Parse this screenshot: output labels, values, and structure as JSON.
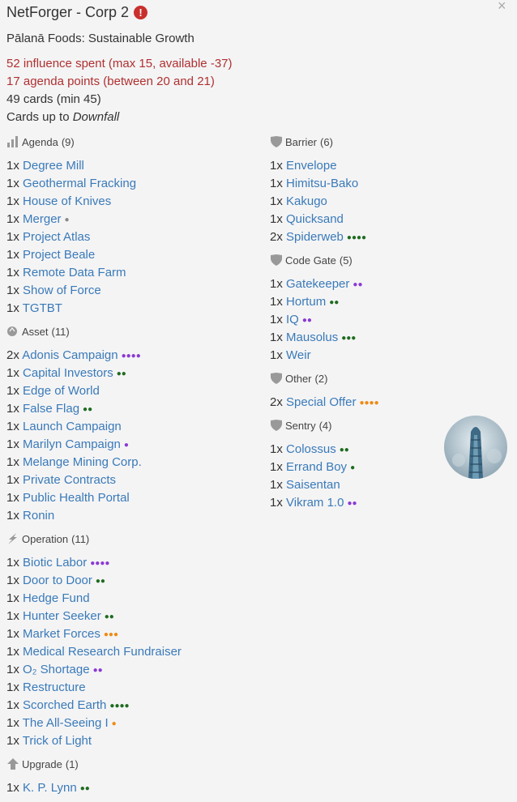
{
  "header": {
    "title": "NetForger - Corp 2",
    "warning_icon": "!",
    "identity": "Pālanā Foods: Sustainable Growth",
    "influence": "52 influence spent (max 15, available -37)",
    "agenda_points": "17 agenda points (between 20 and 21)",
    "cards": "49 cards (min 45)",
    "cards_up_to_prefix": "Cards up to ",
    "cards_up_to_set": "Downfall",
    "close": "×"
  },
  "colors": {
    "link": "#3a7ab8",
    "error": "#b03030",
    "green": "#1e6b1e",
    "purple": "#8a3ad4",
    "orange": "#ef8a12",
    "gray": "#888888"
  },
  "left_column": [
    {
      "type": "Agenda",
      "count": "(9)",
      "icon": "bar-chart-icon",
      "cards": [
        {
          "qty": "1x",
          "name": "Degree Mill",
          "pips": ""
        },
        {
          "qty": "1x",
          "name": "Geothermal Fracking",
          "pips": ""
        },
        {
          "qty": "1x",
          "name": "House of Knives",
          "pips": ""
        },
        {
          "qty": "1x",
          "name": "Merger",
          "pips": "●",
          "color": "gr"
        },
        {
          "qty": "1x",
          "name": "Project Atlas",
          "pips": ""
        },
        {
          "qty": "1x",
          "name": "Project Beale",
          "pips": ""
        },
        {
          "qty": "1x",
          "name": "Remote Data Farm",
          "pips": ""
        },
        {
          "qty": "1x",
          "name": "Show of Force",
          "pips": ""
        },
        {
          "qty": "1x",
          "name": "TGTBT",
          "pips": ""
        }
      ]
    },
    {
      "type": "Asset",
      "count": "(11)",
      "icon": "asset-icon",
      "cards": [
        {
          "qty": "2x",
          "name": "Adonis Campaign",
          "pips": "●●●●",
          "color": "p"
        },
        {
          "qty": "1x",
          "name": "Capital Investors",
          "pips": "●●",
          "color": "g"
        },
        {
          "qty": "1x",
          "name": "Edge of World",
          "pips": ""
        },
        {
          "qty": "1x",
          "name": "False Flag",
          "pips": "●●",
          "color": "g"
        },
        {
          "qty": "1x",
          "name": "Launch Campaign",
          "pips": ""
        },
        {
          "qty": "1x",
          "name": "Marilyn Campaign",
          "pips": "●",
          "color": "p"
        },
        {
          "qty": "1x",
          "name": "Melange Mining Corp.",
          "pips": ""
        },
        {
          "qty": "1x",
          "name": "Private Contracts",
          "pips": ""
        },
        {
          "qty": "1x",
          "name": "Public Health Portal",
          "pips": ""
        },
        {
          "qty": "1x",
          "name": "Ronin",
          "pips": ""
        }
      ]
    },
    {
      "type": "Operation",
      "count": "(11)",
      "icon": "lightning-icon",
      "cards": [
        {
          "qty": "1x",
          "name": "Biotic Labor",
          "pips": "●●●●",
          "color": "p"
        },
        {
          "qty": "1x",
          "name": "Door to Door",
          "pips": "●●",
          "color": "g"
        },
        {
          "qty": "1x",
          "name": "Hedge Fund",
          "pips": ""
        },
        {
          "qty": "1x",
          "name": "Hunter Seeker",
          "pips": "●●",
          "color": "g"
        },
        {
          "qty": "1x",
          "name": "Market Forces",
          "pips": "●●●",
          "color": "o"
        },
        {
          "qty": "1x",
          "name": "Medical Research Fundraiser",
          "pips": ""
        },
        {
          "qty": "1x",
          "name": "O₂ Shortage",
          "pips": "●●",
          "color": "p"
        },
        {
          "qty": "1x",
          "name": "Restructure",
          "pips": ""
        },
        {
          "qty": "1x",
          "name": "Scorched Earth",
          "pips": "●●●●",
          "color": "g"
        },
        {
          "qty": "1x",
          "name": "The All-Seeing I",
          "pips": "●",
          "color": "o"
        },
        {
          "qty": "1x",
          "name": "Trick of Light",
          "pips": ""
        }
      ]
    },
    {
      "type": "Upgrade",
      "count": "(1)",
      "icon": "upgrade-arrow-icon",
      "cards": [
        {
          "qty": "1x",
          "name": "K. P. Lynn",
          "pips": "●●",
          "color": "g"
        }
      ]
    }
  ],
  "right_column": [
    {
      "type": "Barrier",
      "count": "(6)",
      "icon": "shield-icon",
      "cards": [
        {
          "qty": "1x",
          "name": "Envelope",
          "pips": ""
        },
        {
          "qty": "1x",
          "name": "Himitsu-Bako",
          "pips": ""
        },
        {
          "qty": "1x",
          "name": "Kakugo",
          "pips": ""
        },
        {
          "qty": "1x",
          "name": "Quicksand",
          "pips": ""
        },
        {
          "qty": "2x",
          "name": "Spiderweb",
          "pips": "●●●●",
          "color": "g"
        }
      ]
    },
    {
      "type": "Code Gate",
      "count": "(5)",
      "icon": "shield-icon",
      "cards": [
        {
          "qty": "1x",
          "name": "Gatekeeper",
          "pips": "●●",
          "color": "p"
        },
        {
          "qty": "1x",
          "name": "Hortum",
          "pips": "●●",
          "color": "g"
        },
        {
          "qty": "1x",
          "name": "IQ",
          "pips": "●●",
          "color": "p"
        },
        {
          "qty": "1x",
          "name": "Mausolus",
          "pips": "●●●",
          "color": "g"
        },
        {
          "qty": "1x",
          "name": "Weir",
          "pips": ""
        }
      ]
    },
    {
      "type": "Other",
      "count": "(2)",
      "icon": "shield-icon",
      "cards": [
        {
          "qty": "2x",
          "name": "Special Offer",
          "pips": "●●●●",
          "color": "o"
        }
      ]
    },
    {
      "type": "Sentry",
      "count": "(4)",
      "icon": "shield-icon",
      "cards": [
        {
          "qty": "1x",
          "name": "Colossus",
          "pips": "●●",
          "color": "g"
        },
        {
          "qty": "1x",
          "name": "Errand Boy",
          "pips": "●",
          "color": "g"
        },
        {
          "qty": "1x",
          "name": "Saisentan",
          "pips": ""
        },
        {
          "qty": "1x",
          "name": "Vikram 1.0",
          "pips": "●●",
          "color": "p"
        }
      ]
    }
  ]
}
